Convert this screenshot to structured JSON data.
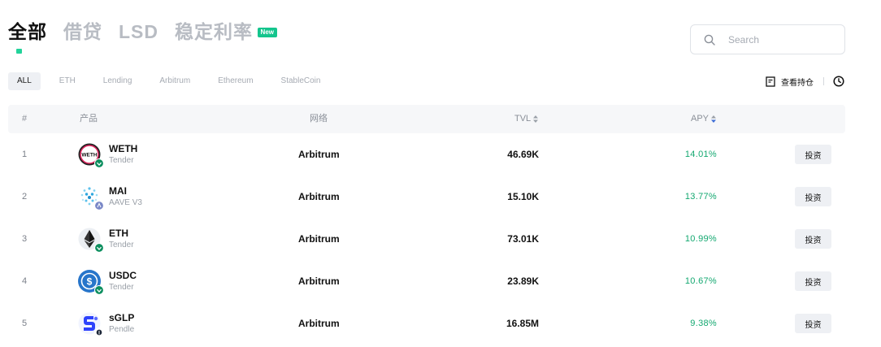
{
  "tabs": [
    {
      "label": "全部"
    },
    {
      "label": "借贷"
    },
    {
      "label": "LSD"
    },
    {
      "label": "稳定利率",
      "badge": "New"
    }
  ],
  "search": {
    "placeholder": "Search"
  },
  "filters": [
    "ALL",
    "ETH",
    "Lending",
    "Arbitrum",
    "Ethereum",
    "StableCoin"
  ],
  "holdings_label": "查看持仓",
  "table": {
    "headers": {
      "index": "#",
      "product": "产品",
      "network": "网络",
      "tvl": "TVL",
      "apy": "APY"
    },
    "rows": [
      {
        "index": "1",
        "name": "WETH",
        "protocol": "Tender",
        "network": "Arbitrum",
        "tvl": "46.69K",
        "apy": "14.01%",
        "action": "投资",
        "icon": "weth-icon",
        "protocol_icon": "tender-icon"
      },
      {
        "index": "2",
        "name": "MAI",
        "protocol": "AAVE V3",
        "network": "Arbitrum",
        "tvl": "15.10K",
        "apy": "13.77%",
        "action": "投资",
        "icon": "mai-icon",
        "protocol_icon": "aave-icon"
      },
      {
        "index": "3",
        "name": "ETH",
        "protocol": "Tender",
        "network": "Arbitrum",
        "tvl": "73.01K",
        "apy": "10.99%",
        "action": "投资",
        "icon": "eth-icon",
        "protocol_icon": "tender-icon"
      },
      {
        "index": "4",
        "name": "USDC",
        "protocol": "Tender",
        "network": "Arbitrum",
        "tvl": "23.89K",
        "apy": "10.67%",
        "action": "投资",
        "icon": "usdc-icon",
        "protocol_icon": "tender-icon"
      },
      {
        "index": "5",
        "name": "sGLP",
        "protocol": "Pendle",
        "network": "Arbitrum",
        "tvl": "16.85M",
        "apy": "9.38%",
        "action": "投资",
        "icon": "sglp-icon",
        "protocol_icon": "pendle-icon"
      }
    ]
  },
  "colors": {
    "accent": "#14c58d",
    "apy_green": "#13a870",
    "muted": "#a6abb3",
    "header_bg": "#f6f7f9"
  }
}
